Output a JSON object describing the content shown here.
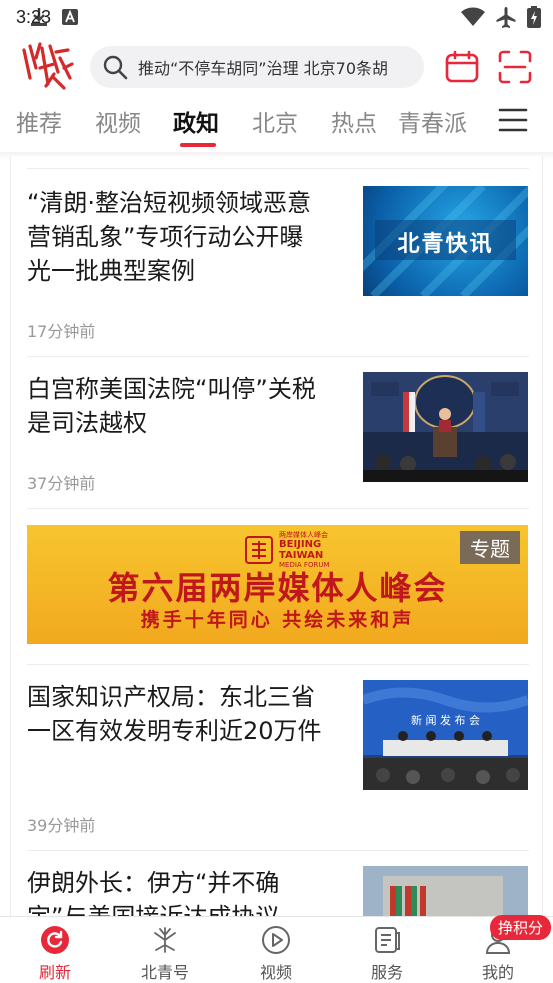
{
  "status_bar": {
    "time": "3:23"
  },
  "header": {
    "logo_text": "北青",
    "search_placeholder": "推动“不停车胡同”治理 北京70条胡"
  },
  "tabs": [
    "推荐",
    "视频",
    "政知",
    "北京",
    "热点",
    "青春派"
  ],
  "active_tab": "政知",
  "articles": [
    {
      "title": "“清朗·整治短视频领域恶意营销乱象”专项行动公开曝光一批典型案例",
      "time": "17分钟前",
      "thumb_text": "北青快讯"
    },
    {
      "title": "白宫称美国法院“叫停”关税是司法越权",
      "time": "37分钟前"
    },
    {
      "title": "国家知识产权局：东北三省一区有效发明专利近20万件",
      "time": "39分钟前",
      "thumb_text": "新 闻 发 布 会"
    },
    {
      "title": "伊朗外长：伊方“并不确定”与美国接近达成协议"
    }
  ],
  "banner": {
    "tag": "专题",
    "emblem_cn": "两岸媒体人峰会",
    "emblem_en1": "BEIJING",
    "emblem_en2": "TAIWAN",
    "emblem_en3": "MEDIA FORUM",
    "title": "第六届两岸媒体人峰会",
    "subtitle": "携手十年同心 共绘未来和声"
  },
  "bottom_nav": [
    {
      "label": "刷新",
      "icon": "refresh-icon"
    },
    {
      "label": "北青号",
      "icon": "flower-icon"
    },
    {
      "label": "视频",
      "icon": "play-icon"
    },
    {
      "label": "服务",
      "icon": "document-icon"
    },
    {
      "label": "我的",
      "icon": "person-icon"
    }
  ],
  "points_badge": "挣积分",
  "colors": {
    "accent": "#e6283a",
    "banner_yellow": "#f5b824",
    "banner_red": "#c0171c"
  }
}
